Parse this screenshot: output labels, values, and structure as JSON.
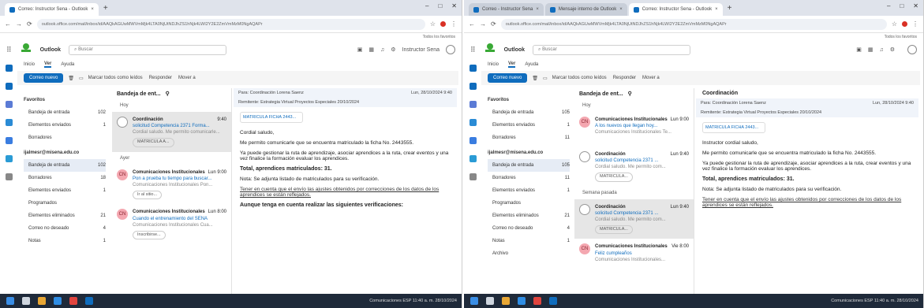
{
  "colors": {
    "brand": "#0f6cbd",
    "sena_green": "#39a935",
    "taskbar": "#1f2a3a"
  },
  "left": {
    "tabs": [
      {
        "label": "Correo: Instructor Sena - Outlook"
      }
    ],
    "new_tab": "+",
    "url": "outlook.office.com/mail/inbox/id/AAQkAGUwMWVmMjk4LTA0NjUtNDJhZS1hNjk4LWI2Y2E2ZmVmMzM0NgAQAPr",
    "bookmarks": "Todos los favoritos",
    "app_title": "Outlook",
    "search_placeholder": "Buscar",
    "account": "Instructor Sena",
    "ribbon": [
      "Inicio",
      "Ver",
      "Ayuda"
    ],
    "toolbar": {
      "new_mail": "Correo nuevo",
      "items": [
        "Marcar todos como leídos",
        "Responder",
        "Mover a"
      ]
    },
    "folders": {
      "favorites": "Favoritos",
      "fav_items": [
        {
          "label": "Bandeja de entrada",
          "count": "102"
        },
        {
          "label": "Elementos enviados",
          "count": "1"
        },
        {
          "label": "Borradores",
          "count": ""
        }
      ],
      "account": "ijalmesr@misena.edu.co",
      "items": [
        {
          "label": "Bandeja de entrada",
          "count": "102"
        },
        {
          "label": "Borradores",
          "count": "18"
        },
        {
          "label": "Elementos enviados",
          "count": "1"
        },
        {
          "label": "Programados",
          "count": ""
        },
        {
          "label": "Elementos eliminados",
          "count": "21"
        },
        {
          "label": "Correo no deseado",
          "count": "4"
        },
        {
          "label": "Notas",
          "count": "1"
        }
      ]
    },
    "list": {
      "title": "Bandeja de ent...",
      "groups": [
        "Hoy",
        "Ayer"
      ],
      "items": [
        {
          "avatar": "",
          "sender": "Coordinación",
          "subject": "solicitud Competencia 2371 Forma...",
          "time": "9:40",
          "preview": "Cordial saludo. Me permito comunicarle...",
          "attachment": "MATRICULA A..."
        },
        {
          "avatar": "CN",
          "sender": "Comunicaciones Institucionales",
          "subject": "Pon a prueba tu tiempo para buscar...",
          "time": "Lun 9:00",
          "preview": "Comunicaciones Institucionales Pon...",
          "attachment": "Ir al sitio..."
        },
        {
          "avatar": "CN",
          "sender": "Comunicaciones Institucionales",
          "subject": "Cuando el entrenamiento del SENA",
          "time": "Lun 8:00",
          "preview": "Comunicaciones Institucionales Cua...",
          "attachment": "Inscribirse..."
        }
      ]
    },
    "reading": {
      "to": "Para: Coordinación Lorena Saenz",
      "date": "Lun, 28/10/2024 9:40",
      "banner": "Remitente: Estrategia Virtual Proyectos Especiales 20/10/2024",
      "attachment": "MATRICULA FICHA 2443...",
      "lines": [
        {
          "text": "Cordial saludo,",
          "style": ""
        },
        {
          "text": "Me permito comunicarle que se encuentra matriculado la ficha No. 2443555.",
          "style": ""
        },
        {
          "text": "Ya puede gestionar la ruta de aprendizaje, asociar aprendices a la ruta, crear eventos y una vez finalice la formación evaluar los aprendices.",
          "style": ""
        },
        {
          "text": "Total, aprendices matriculados: 31.",
          "style": "b"
        },
        {
          "text": "Nota: Se adjunta listado de matriculados para su verificación.",
          "style": ""
        },
        {
          "text": "Tener en cuenta que el envío las ajustes obtenidos por correcciones de los datos de los aprendices se están reflejados.",
          "style": "u"
        },
        {
          "text": "Aunque tenga en cuenta realizar las siguientes verificaciones:",
          "style": "b"
        }
      ]
    },
    "tray": "Comunicaciones  ESP  11:40 a. m. 28/10/2024"
  },
  "right": {
    "tabs": [
      {
        "label": "Correo - Instructor Sena"
      },
      {
        "label": "Mensaje interno de Outlook"
      },
      {
        "label": "Correo: Instructor Sena - Outlook"
      }
    ],
    "new_tab": "+",
    "url": "outlook.office.com/mail/inbox/id/AAQkAGUwMWVmMjk4LTA0NjUtNDJhZS1hNjk4LWI2Y2E2ZmVmMzM0NgAQAPr",
    "bookmarks": "Todos los favoritos",
    "app_title": "Outlook",
    "search_placeholder": "Buscar",
    "ribbon": [
      "Inicio",
      "Ver",
      "Ayuda"
    ],
    "toolbar": {
      "new_mail": "Correo nuevo",
      "items": [
        "Marcar todos como leídos",
        "Responder",
        "Mover a"
      ]
    },
    "folders": {
      "favorites": "Favoritos",
      "fav_items": [
        {
          "label": "Bandeja de entrada",
          "count": "105"
        },
        {
          "label": "Elementos enviados",
          "count": "1"
        },
        {
          "label": "Borradores",
          "count": "11"
        }
      ],
      "account": "ijalmesr@misena.edu.co",
      "items": [
        {
          "label": "Bandeja de entrada",
          "count": "105"
        },
        {
          "label": "Borradores",
          "count": "11"
        },
        {
          "label": "Elementos enviados",
          "count": "1"
        },
        {
          "label": "Programados",
          "count": ""
        },
        {
          "label": "Elementos eliminados",
          "count": "21"
        },
        {
          "label": "Correo no deseado",
          "count": "4"
        },
        {
          "label": "Notas",
          "count": "1"
        },
        {
          "label": "Archivo",
          "count": ""
        }
      ]
    },
    "list": {
      "title": "Bandeja de ent...",
      "groups": [
        "Hoy",
        "Semana pasada"
      ],
      "items": [
        {
          "avatar": "CN",
          "sender": "Comunicaciones Institucionales",
          "subject": "A los nuevos que llegan hoy...",
          "time": "Lun 9:00",
          "preview": "Comunicaciones Institucionales Te...",
          "attachment": ""
        },
        {
          "avatar": "",
          "sender": "Coordinación",
          "subject": "solicitud Competencia 2371 ...",
          "time": "Lun 9:40",
          "preview": "Cordial saludo. Me permito com...",
          "attachment": "MATRICULA..."
        },
        {
          "avatar": "",
          "sender": "Coordinación",
          "subject": "solicitud Competencia 2371 ...",
          "time": "Lun 9:40",
          "preview": "Cordial saludo. Me permito com...",
          "attachment": "MATRICULA..."
        },
        {
          "avatar": "CN",
          "sender": "Comunicaciones Institucionales",
          "subject": "Feliz cumpleaños",
          "time": "Vie 8:00",
          "preview": "Comunicaciones Institucionales...",
          "attachment": ""
        }
      ]
    },
    "reading": {
      "from": "Coordinación",
      "to": "Para: Coordinación Lorena Saenz",
      "date": "Lun, 28/10/2024 9:40",
      "banner": "Remitente: Estrategia Virtual Proyectos Especiales 20/10/2024",
      "attachment": "MATRICULA FICHA 2443...",
      "lines": [
        {
          "text": "Instructor cordial saludo,",
          "style": ""
        },
        {
          "text": "Me permito comunicarle que se encuentra matriculado la ficha No. 2443555.",
          "style": ""
        },
        {
          "text": "Ya puede gestionar la ruta de aprendizaje, asociar aprendices a la ruta, crear eventos y una vez finalice la formación evaluar los aprendices.",
          "style": ""
        },
        {
          "text": "Total, aprendices matriculados: 31.",
          "style": "b"
        },
        {
          "text": "Nota: Se adjunta listado de matriculados para su verificación.",
          "style": ""
        },
        {
          "text": "Tener en cuenta que el envío las ajustes obtenidos por correcciones de los datos de los aprendices se están reflejados.",
          "style": "u"
        }
      ]
    },
    "tray": "Comunicaciones  ESP  11:40 a. m. 28/10/2024"
  }
}
